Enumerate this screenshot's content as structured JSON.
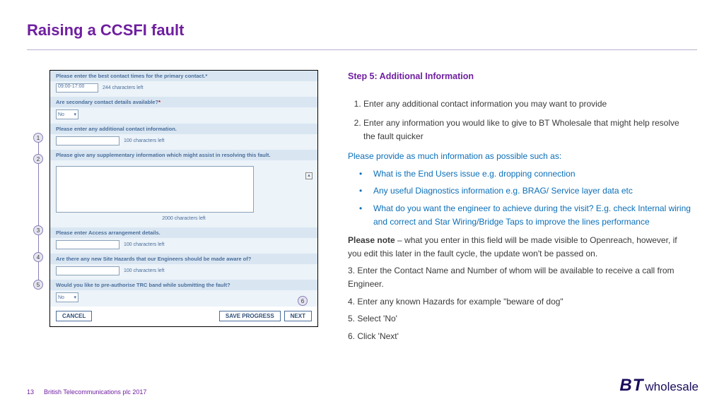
{
  "pageTitle": "Raising a CCSFI fault",
  "pageNumber": "13",
  "footerText": "British Telecommunications plc 2017",
  "brand": {
    "b": "B",
    "t": "T",
    "suffix": "wholesale"
  },
  "form": {
    "sections": {
      "top": {
        "header": "Please enter the best contact times for the primary contact.*",
        "timeValue": "09:00-17:00",
        "chars": "244 characters left"
      },
      "secondary": {
        "header": "Are secondary contact details available?",
        "selectValue": "No"
      },
      "additional": {
        "header": "Please enter any additional contact information.",
        "chars": "100 characters left"
      },
      "supplementary": {
        "header": "Please give any supplementary information which might assist in resolving this fault.",
        "chars": "2000 characters left"
      },
      "access": {
        "header": "Please enter Access arrangement details.",
        "chars": "100 characters left"
      },
      "hazards": {
        "header": "Are there any new Site Hazards that our Engineers should be made aware of?",
        "chars": "100 characters left"
      },
      "trc": {
        "header": "Would you like to pre-authorise TRC band while submitting the fault?",
        "selectValue": "No"
      }
    },
    "buttons": {
      "cancel": "CANCEL",
      "save": "SAVE PROGRESS",
      "next": "NEXT"
    },
    "callouts": [
      "1",
      "2",
      "3",
      "4",
      "5",
      "6"
    ]
  },
  "explain": {
    "stepTitle": "Step 5: Additional Information",
    "ol": [
      "Enter any additional contact information you may want to provide",
      "Enter any information you would like to give to BT Wholesale that might help resolve the fault quicker"
    ],
    "subLead": "Please provide as much information as possible such as:",
    "ul": [
      "What is the End Users issue e.g. dropping connection",
      "Any useful Diagnostics information e.g. BRAG/ Service layer data etc",
      "What do you want the engineer to achieve during the visit? E.g. check Internal wiring and correct and Star Wiring/Bridge Taps to improve the lines performance"
    ],
    "noteStrong": "Please note",
    "noteRest": " – what you enter in this field will be made visible to Openreach, however, if you edit this later in the fault cycle, the update won't be passed on.",
    "p3": "3. Enter the Contact Name and Number of whom will be available to receive a call from Engineer.",
    "p4": "4. Enter any known Hazards for example \"beware of dog\"",
    "p5": "5. Select 'No'",
    "p6": "6. Click 'Next'"
  }
}
